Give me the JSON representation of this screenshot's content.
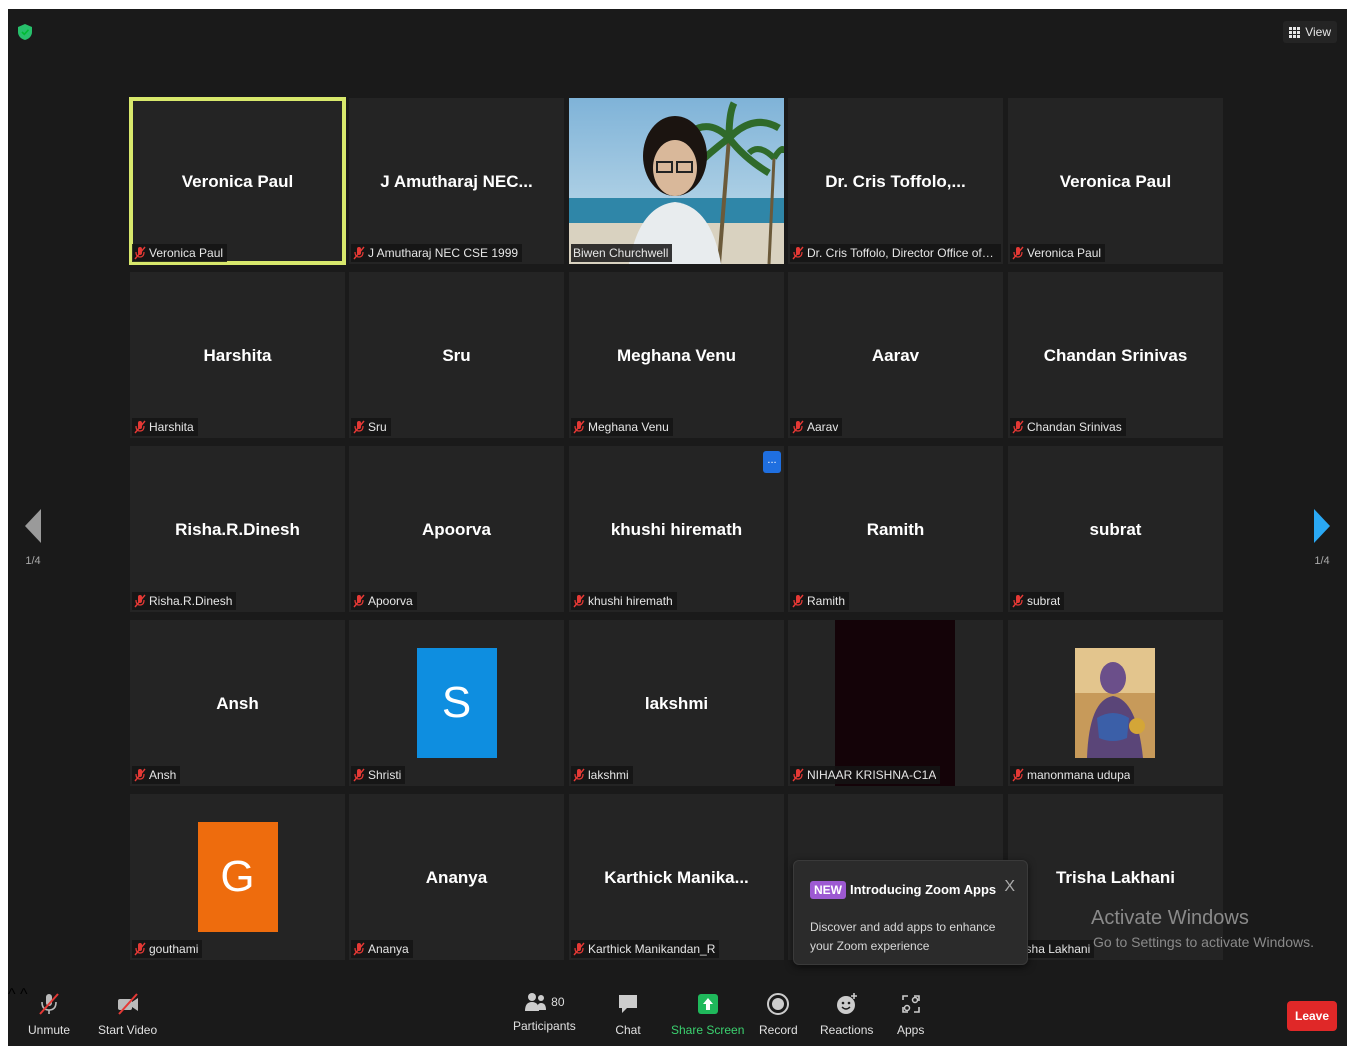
{
  "header": {
    "view_label": "View"
  },
  "pager": {
    "left": "1/4",
    "right": "1/4"
  },
  "tiles": [
    {
      "name": "Veronica Paul",
      "label": "Veronica Paul"
    },
    {
      "name": "J Amutharaj NEC...",
      "label": "J Amutharaj NEC CSE 1999"
    },
    {
      "name": "",
      "label": "Biwen Churchwell"
    },
    {
      "name": "Dr. Cris Toffolo,...",
      "label": "Dr. Cris Toffolo, Director Office of Inte..."
    },
    {
      "name": "Veronica Paul",
      "label": "Veronica Paul"
    },
    {
      "name": "Harshita",
      "label": "Harshita"
    },
    {
      "name": "Sru",
      "label": "Sru"
    },
    {
      "name": "Meghana Venu",
      "label": "Meghana Venu"
    },
    {
      "name": "Aarav",
      "label": "Aarav"
    },
    {
      "name": "Chandan Srinivas",
      "label": "Chandan Srinivas"
    },
    {
      "name": "Risha.R.Dinesh",
      "label": "Risha.R.Dinesh"
    },
    {
      "name": "Apoorva",
      "label": "Apoorva"
    },
    {
      "name": "khushi hiremath",
      "label": "khushi hiremath"
    },
    {
      "name": "Ramith",
      "label": "Ramith"
    },
    {
      "name": "subrat",
      "label": "subrat"
    },
    {
      "name": "Ansh",
      "label": "Ansh"
    },
    {
      "name": "",
      "label": "Shristi",
      "avatar_letter": "S"
    },
    {
      "name": "lakshmi",
      "label": "lakshmi"
    },
    {
      "name": "",
      "label": "NIHAAR KRISHNA-C1A"
    },
    {
      "name": "",
      "label": "manonmana udupa"
    },
    {
      "name": "",
      "label": "gouthami",
      "avatar_letter": "G"
    },
    {
      "name": "Ananya",
      "label": "Ananya"
    },
    {
      "name": "Karthick Manika...",
      "label": "Karthick Manikandan_R"
    },
    {
      "name": "",
      "label": ""
    },
    {
      "name": "Trisha Lakhani",
      "label": "Trisha Lakhani"
    }
  ],
  "more_button": "...",
  "popup": {
    "badge": "NEW",
    "title": "Introducing Zoom Apps",
    "close": "X",
    "body": "Discover and add apps to enhance your Zoom experience"
  },
  "watermark": {
    "line1": "Activate Windows",
    "line2": "Go to Settings to activate Windows."
  },
  "toolbar": {
    "unmute": "Unmute",
    "start_video": "Start Video",
    "participants": "Participants",
    "participant_count": "80",
    "chat": "Chat",
    "share_screen": "Share Screen",
    "record": "Record",
    "reactions": "Reactions",
    "apps": "Apps",
    "leave": "Leave",
    "caret": "^"
  },
  "colors": {
    "active_speaker": "#d8e86c",
    "avatar_s": "#0e8ee0",
    "avatar_g": "#ee6c0d",
    "share_green": "#3bd16f",
    "leave_red": "#e02828",
    "new_badge": "#9d59d2",
    "muted_red": "#e53935"
  }
}
